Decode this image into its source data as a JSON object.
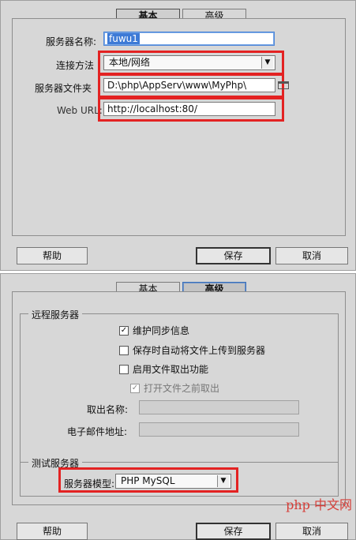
{
  "basic": {
    "tabs": [
      "基本",
      "高级"
    ],
    "server_name_label": "服务器名称:",
    "server_name_value": "fuwu1",
    "connection_label": "连接方法",
    "connection_value": "本地/网络",
    "folder_label": "服务器文件夹",
    "folder_value": "D:\\php\\AppServ\\www\\MyPhp\\",
    "web_url_label": "Web URL:",
    "web_url_value": "http://localhost:80/",
    "help": "帮助",
    "save": "保存",
    "cancel": "取消"
  },
  "advanced": {
    "tabs": [
      "基本",
      "高级"
    ],
    "remote_group": "远程服务器",
    "maintain_sync": "维护同步信息",
    "auto_upload": "保存时自动将文件上传到服务器",
    "checkout": "启用文件取出功能",
    "open_before_checkout": "打开文件之前取出",
    "checkout_name_label": "取出名称:",
    "email_label": "电子邮件地址:",
    "testing_group": "测试服务器",
    "model_label": "服务器模型:",
    "model_value": "PHP MySQL",
    "help": "帮助",
    "save": "保存",
    "cancel": "取消"
  },
  "watermark": "php 中文网"
}
